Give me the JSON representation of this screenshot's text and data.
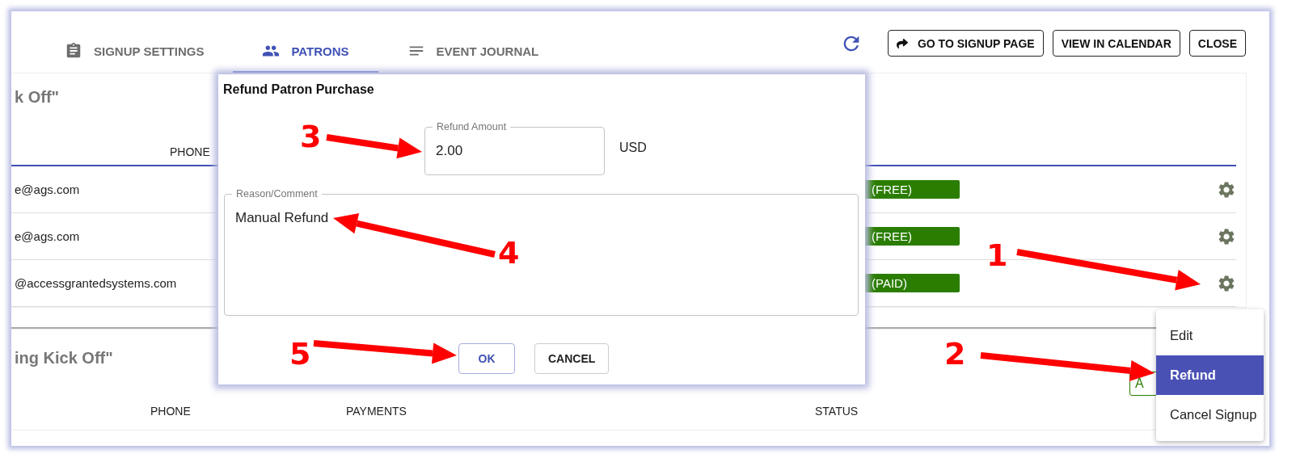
{
  "tabs": [
    {
      "label": "SIGNUP SETTINGS",
      "kind": "clipboard",
      "selected": false
    },
    {
      "label": "PATRONS",
      "kind": "people",
      "selected": true
    },
    {
      "label": "EVENT JOURNAL",
      "kind": "lines",
      "selected": false
    }
  ],
  "toolbar": {
    "buttons": [
      {
        "label": "GO TO SIGNUP PAGE",
        "kind": "share"
      },
      {
        "label": "VIEW IN CALENDAR",
        "kind": "plain"
      },
      {
        "label": "CLOSE",
        "kind": "plain"
      }
    ]
  },
  "events": [
    {
      "title": "k Off\"",
      "columns": [
        "PHONE"
      ],
      "rows": [
        {
          "email": "e@ags.com",
          "status": "(FREE)"
        },
        {
          "email": "e@ags.com",
          "status": "(FREE)"
        },
        {
          "email": "@accessgrantedsystems.com",
          "status": "(PAID)"
        }
      ]
    },
    {
      "title": "ing Kick Off\"",
      "columns": [
        "PHONE",
        "PAYMENTS",
        "STATUS"
      ],
      "action": "A"
    }
  ],
  "dialog": {
    "title": "Refund Patron Purchase",
    "amount": {
      "label": "Refund Amount",
      "value": "2.00"
    },
    "currency": "USD",
    "reason": {
      "label": "Reason/Comment",
      "value": "Manual Refund"
    },
    "buttons": [
      {
        "label": "OK",
        "focused": true
      },
      {
        "label": "CANCEL",
        "focused": false
      }
    ]
  },
  "menu": {
    "items": [
      {
        "label": "Edit",
        "selected": false
      },
      {
        "label": "Refund",
        "selected": true
      },
      {
        "label": "Cancel Signup",
        "selected": false
      }
    ]
  },
  "annotations": [
    {
      "number": "1"
    },
    {
      "number": "2"
    },
    {
      "number": "3"
    },
    {
      "number": "4"
    },
    {
      "number": "5"
    }
  ]
}
